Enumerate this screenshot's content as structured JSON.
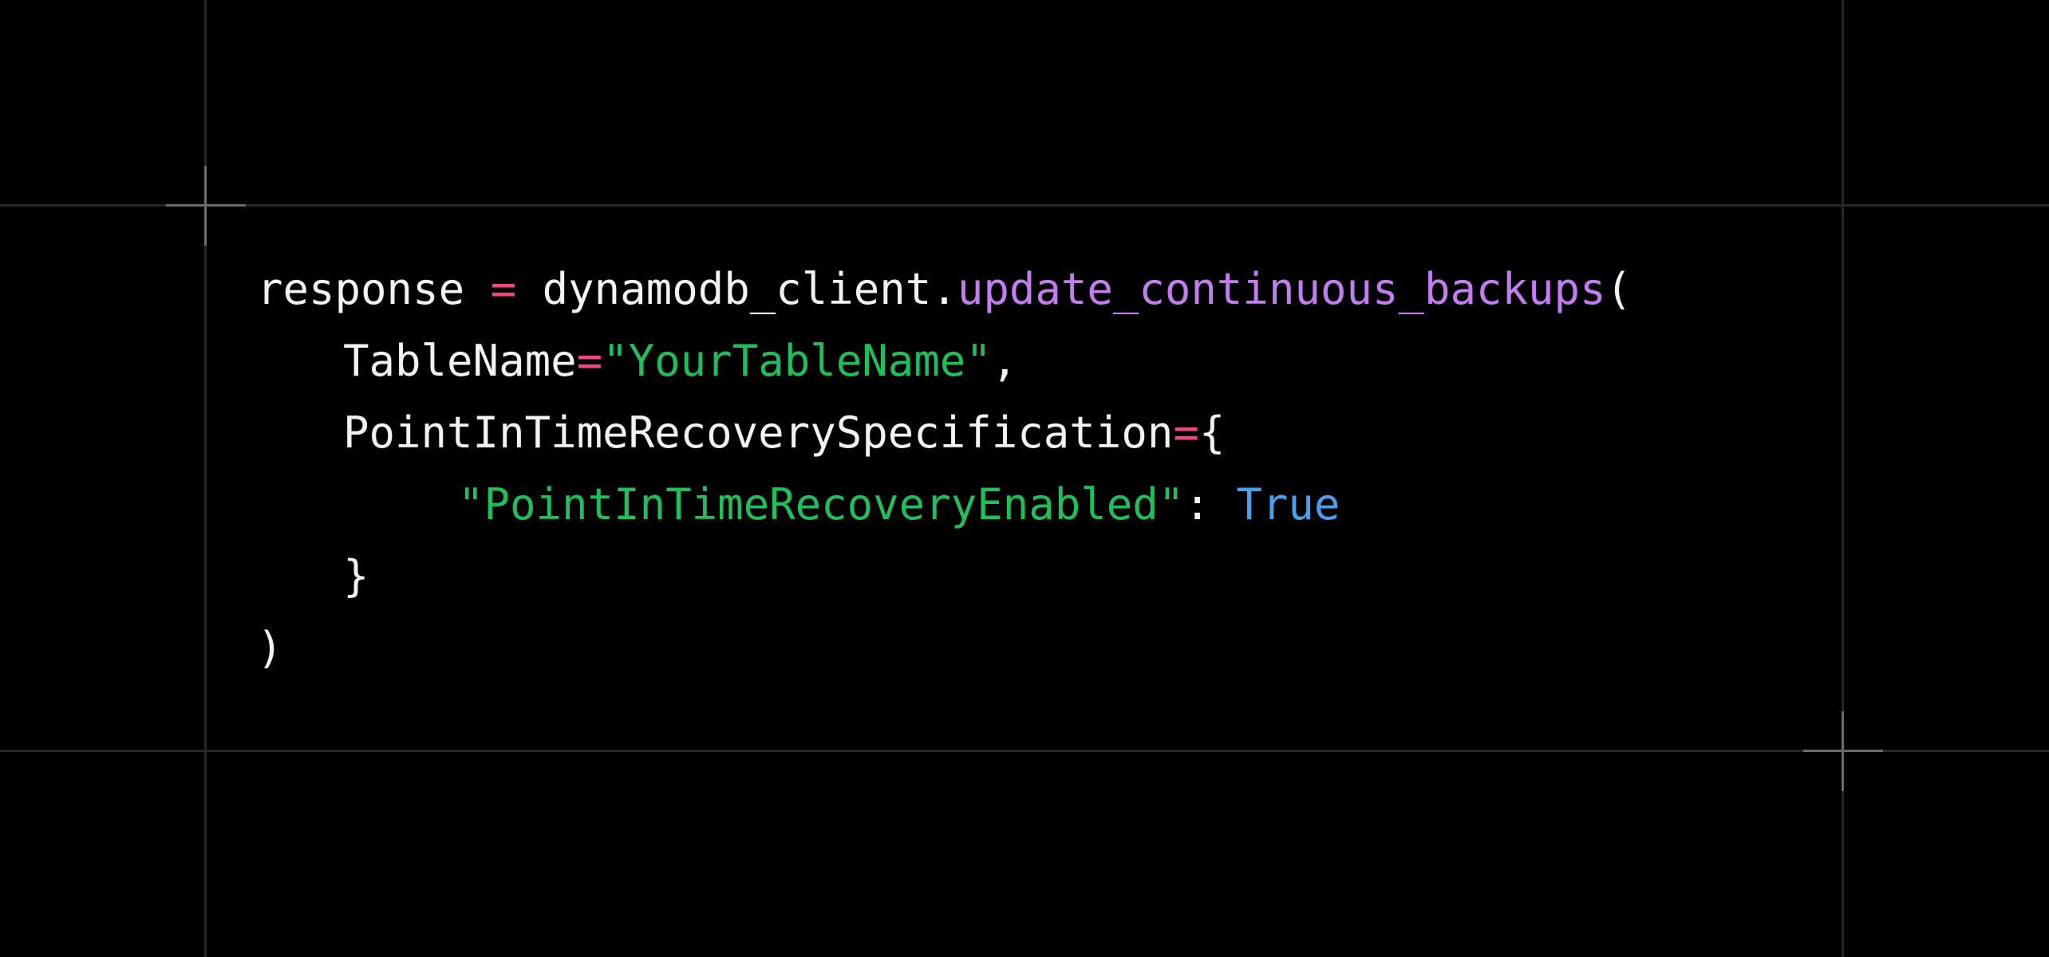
{
  "colors": {
    "background": "#000000",
    "plain": "#f2f2f2",
    "operator": "#f0487c",
    "function": "#c47df0",
    "string": "#1fbf5c",
    "keyword": "#4aa0ee",
    "grid_line": "#262626",
    "crosshair": "#6b6b6b"
  },
  "code": {
    "line1": {
      "var": "response",
      "eq": "=",
      "obj": "dynamodb_client.",
      "func": "update_continuous_backups",
      "open": "("
    },
    "line2": {
      "key": "TableName",
      "eq": "=",
      "value": "\"YourTableName\"",
      "comma": ","
    },
    "line3": {
      "key": "PointInTimeRecoverySpecification",
      "eq": "=",
      "brace": "{"
    },
    "line4": {
      "key": "\"PointInTimeRecoveryEnabled\"",
      "colon": ":",
      "value": "True"
    },
    "line5": {
      "brace": "}"
    },
    "line6": {
      "close": ")"
    }
  }
}
